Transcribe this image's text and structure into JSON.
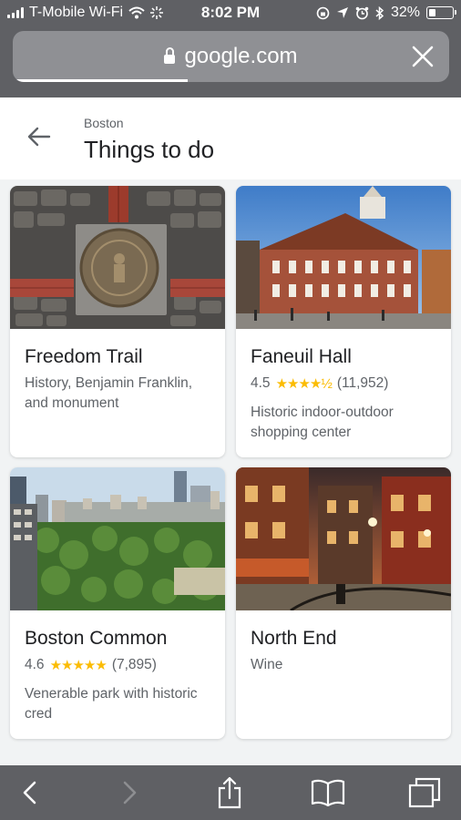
{
  "status": {
    "carrier": "T-Mobile Wi-Fi",
    "time": "8:02 PM",
    "battery": "32%",
    "battery_level": 0.32
  },
  "browser": {
    "url": "google.com",
    "load_progress": 0.4
  },
  "header": {
    "subtitle": "Boston",
    "title": "Things to do"
  },
  "cards": [
    {
      "name": "Freedom Trail",
      "description": "History, Benjamin Franklin, and monument"
    },
    {
      "name": "Faneuil Hall",
      "rating": "4.5",
      "stars": "★★★★½",
      "reviews": "(11,952)",
      "description": "Historic indoor-outdoor shopping center"
    },
    {
      "name": "Boston Common",
      "rating": "4.6",
      "stars": "★★★★★",
      "reviews": "(7,895)",
      "description": "Venerable park with historic cred"
    },
    {
      "name": "North End",
      "description": "Wine"
    }
  ],
  "colors": {
    "chrome": "#5f6064",
    "star": "#fbbc04",
    "text_primary": "#202124",
    "text_secondary": "#5f6368"
  }
}
